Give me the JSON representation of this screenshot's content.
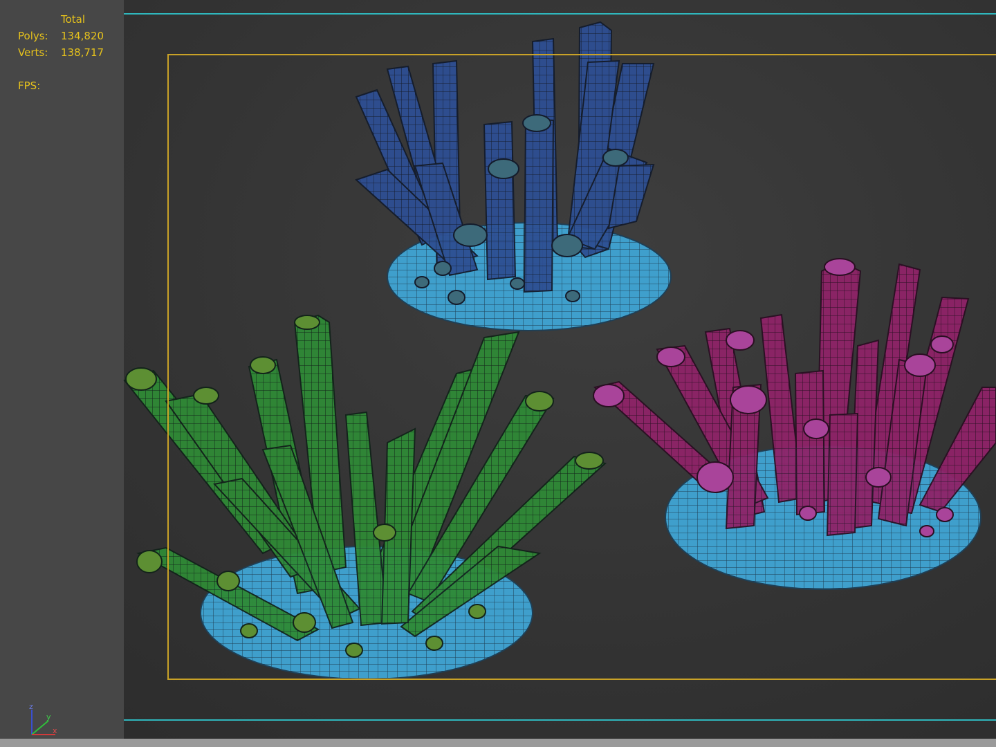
{
  "stats": {
    "header": "Total",
    "polys_label": "Polys:",
    "polys_value": "134,820",
    "verts_label": "Verts:",
    "verts_value": "138,717",
    "fps_label": "FPS:"
  },
  "axis": {
    "z": "z",
    "y": "y",
    "x": "x"
  },
  "colors": {
    "stats_text": "#e6c21c",
    "safe_frame": "#c9a227",
    "letterbox": "#2fb7bd",
    "base": "#3fa3cf",
    "blue_crystal": "#2a3f8f",
    "green_crystal": "#2f7d2f",
    "pink_crystal": "#8e1f66"
  },
  "objects": [
    "blue-crystal-cluster",
    "green-crystal-cluster",
    "pink-crystal-cluster"
  ]
}
